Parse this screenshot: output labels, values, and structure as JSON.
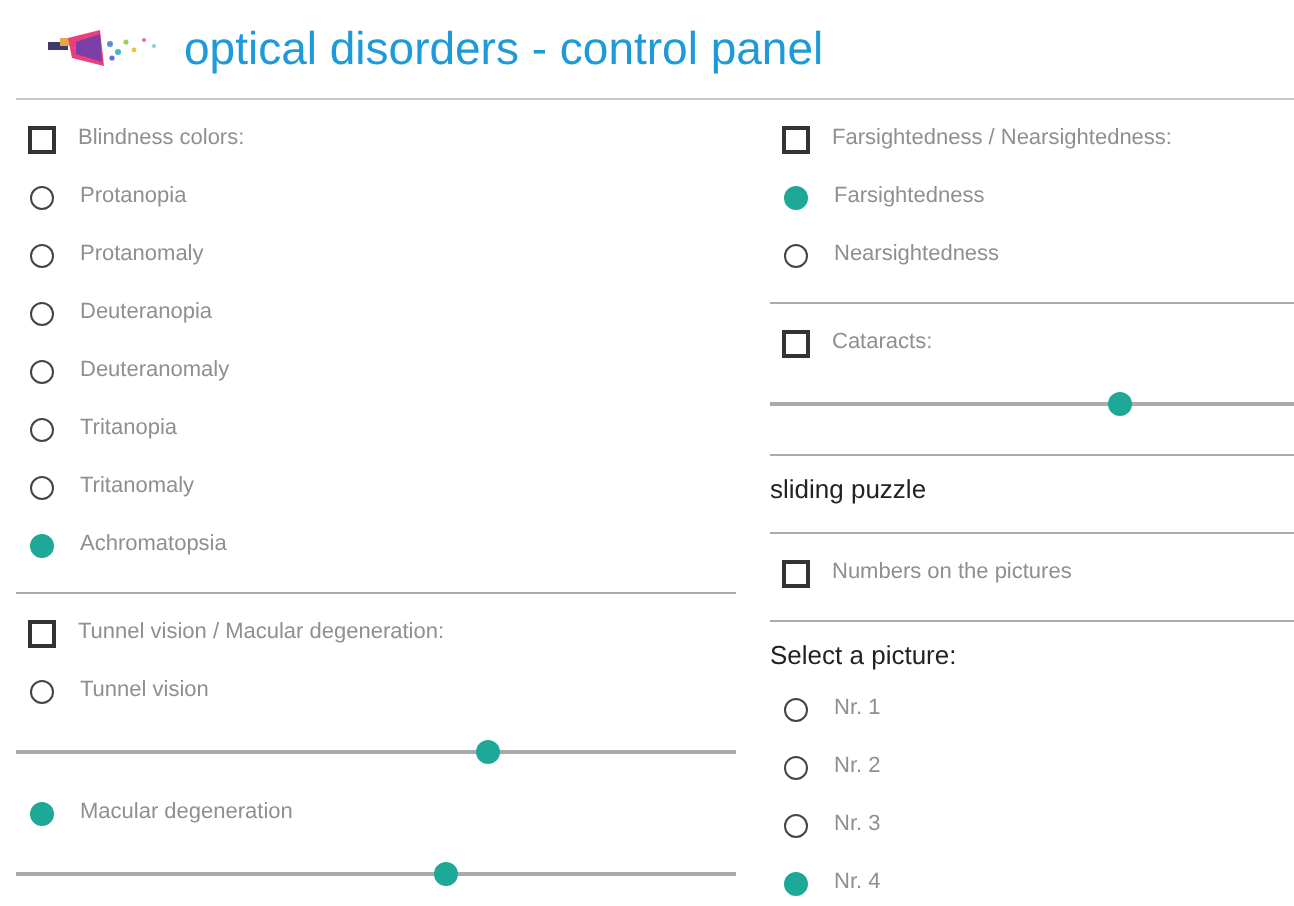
{
  "header": {
    "title": "optical disorders - control panel"
  },
  "columns": [
    {
      "sections": [
        {
          "items": [
            {
              "kind": "checkbox",
              "label": "Blindness colors:",
              "checked": false
            },
            {
              "kind": "radio",
              "label": "Protanopia",
              "selected": false
            },
            {
              "kind": "radio",
              "label": "Protanomaly",
              "selected": false
            },
            {
              "kind": "radio",
              "label": "Deuteranopia",
              "selected": false
            },
            {
              "kind": "radio",
              "label": "Deuteranomaly",
              "selected": false
            },
            {
              "kind": "radio",
              "label": "Tritanopia",
              "selected": false
            },
            {
              "kind": "radio",
              "label": "Tritanomaly",
              "selected": false
            },
            {
              "kind": "radio",
              "label": "Achromatopsia",
              "selected": true
            }
          ]
        },
        {
          "items": [
            {
              "kind": "checkbox",
              "label": "Tunnel vision / Macular degeneration:",
              "checked": false
            },
            {
              "kind": "radio",
              "label": "Tunnel vision",
              "selected": false
            },
            {
              "kind": "slider",
              "level": 0.655
            },
            {
              "kind": "radio",
              "label": "Macular degeneration",
              "selected": true
            },
            {
              "kind": "slider",
              "level": 0.596
            }
          ]
        }
      ]
    },
    {
      "sections": [
        {
          "items": [
            {
              "kind": "checkbox",
              "label": "Farsightedness / Nearsightedness:",
              "checked": false
            },
            {
              "kind": "radio",
              "label": "Farsightedness",
              "selected": true
            },
            {
              "kind": "radio",
              "label": "Nearsightedness",
              "selected": false
            }
          ]
        },
        {
          "items": [
            {
              "kind": "checkbox",
              "label": "Cataracts:",
              "checked": false
            },
            {
              "kind": "slider",
              "level": 0.668
            }
          ]
        },
        {
          "items": [
            {
              "kind": "heading",
              "label": "sliding puzzle"
            }
          ]
        },
        {
          "items": [
            {
              "kind": "checkbox",
              "label": "Numbers on the pictures",
              "checked": false
            }
          ]
        },
        {
          "items": [
            {
              "kind": "heading",
              "label": "Select a picture:"
            },
            {
              "kind": "radio",
              "label": "Nr. 1",
              "selected": false
            },
            {
              "kind": "radio",
              "label": "Nr. 2",
              "selected": false
            },
            {
              "kind": "radio",
              "label": "Nr. 3",
              "selected": false
            },
            {
              "kind": "radio",
              "label": "Nr. 4",
              "selected": true
            }
          ]
        }
      ]
    }
  ]
}
